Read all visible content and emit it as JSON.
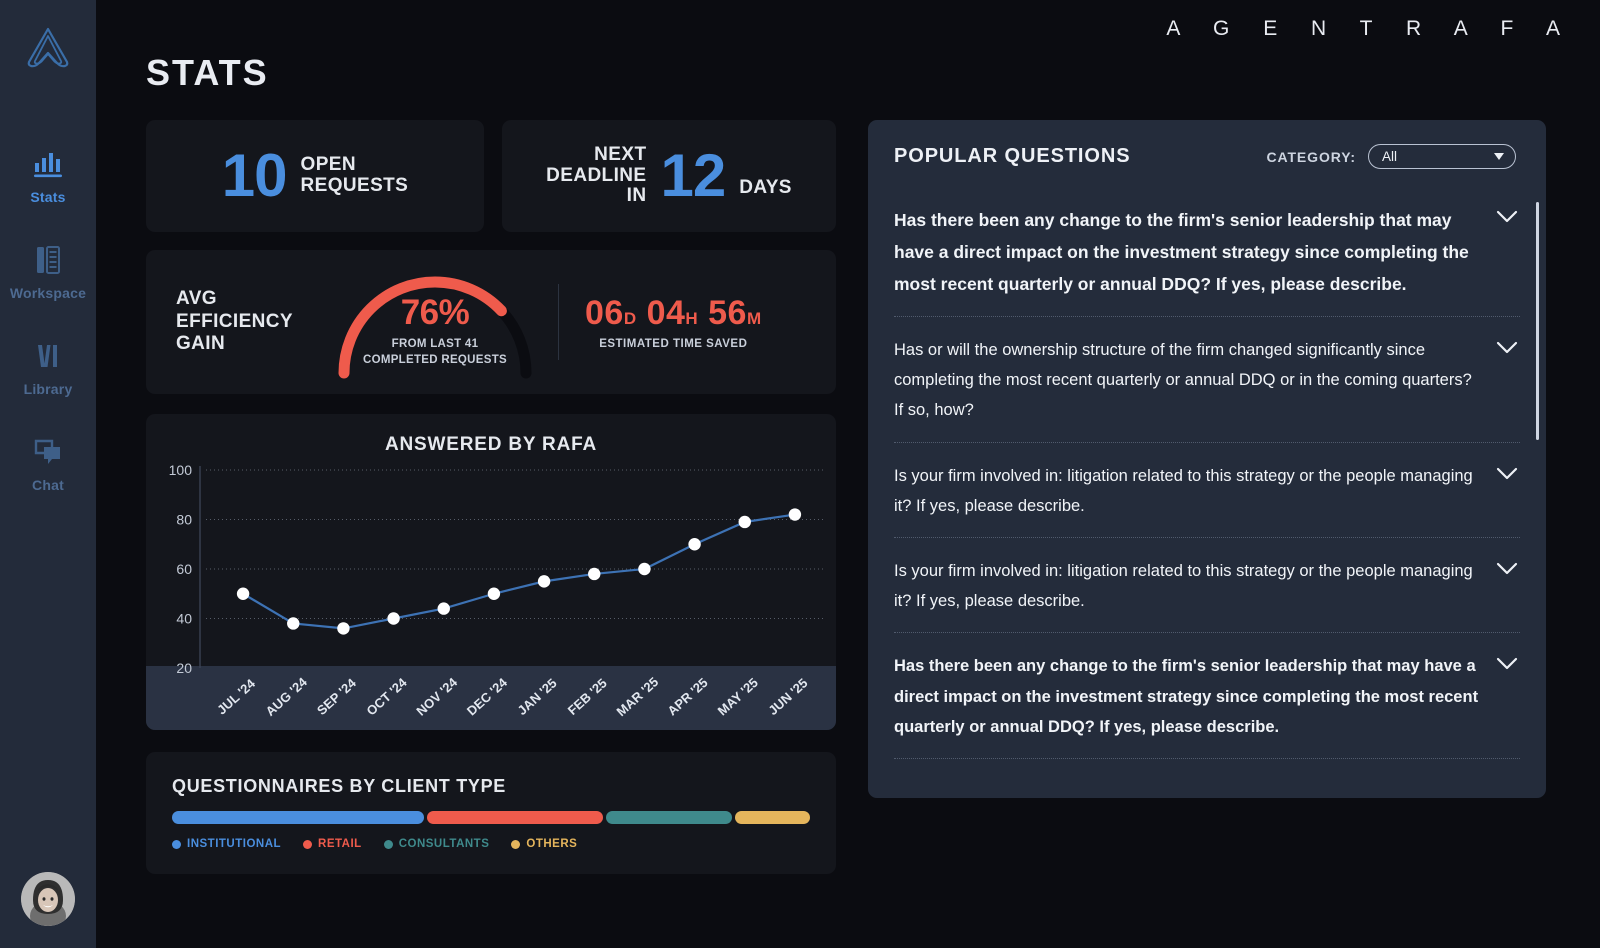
{
  "brand": {
    "title": "A G E N T   R A F A"
  },
  "page": {
    "title": "STATS"
  },
  "sidebar": {
    "logo_name": "rafa-logo",
    "items": [
      {
        "label": "Stats",
        "icon": "bar-chart-icon",
        "active": true
      },
      {
        "label": "Workspace",
        "icon": "workspace-icon",
        "active": false
      },
      {
        "label": "Library",
        "icon": "library-icon",
        "active": false
      },
      {
        "label": "Chat",
        "icon": "chat-icon",
        "active": false
      }
    ],
    "avatar_name": "user-avatar"
  },
  "stats": {
    "open_requests": {
      "value": "10",
      "label_line1": "OPEN",
      "label_line2": "REQUESTS"
    },
    "next_deadline": {
      "label_line1": "NEXT",
      "label_line2": "DEADLINE",
      "label_line3": "IN",
      "value": "12",
      "unit": "DAYS"
    }
  },
  "efficiency": {
    "title_line1": "AVG",
    "title_line2": "EFFICIENCY",
    "title_line3": "GAIN",
    "percent": "76%",
    "percent_value": 76,
    "sub_line1": "FROM LAST 41",
    "sub_line2": "COMPLETED REQUESTS",
    "time_saved": {
      "days": "06",
      "days_unit": "D",
      "hours": "04",
      "hours_unit": "H",
      "minutes": "56",
      "minutes_unit": "M"
    },
    "time_saved_label": "ESTIMATED TIME SAVED",
    "accent": "#ef5b4c"
  },
  "chart_data": {
    "type": "line",
    "title": "ANSWERED BY RAFA",
    "xlabel": "",
    "ylabel": "",
    "ylim": [
      20,
      100
    ],
    "yticks": [
      20,
      40,
      60,
      80,
      100
    ],
    "grid": true,
    "legend": "none",
    "categories": [
      "JUL '24",
      "AUG '24",
      "SEP '24",
      "OCT '24",
      "NOV '24",
      "DEC '24",
      "JAN '25",
      "FEB '25",
      "MAR '25",
      "APR '25",
      "MAY '25",
      "JUN '25"
    ],
    "series": [
      {
        "name": "Answered by Rafa",
        "color": "#3d72b4",
        "marker_color": "#ffffff",
        "values": [
          50,
          38,
          36,
          40,
          44,
          50,
          55,
          58,
          60,
          70,
          79,
          82
        ]
      }
    ]
  },
  "clients": {
    "title": "QUESTIONNAIRES BY CLIENT TYPE",
    "segments": [
      {
        "label": "INSTITUTIONAL",
        "color": "#4a8ede",
        "percent": 40
      },
      {
        "label": "RETAIL",
        "color": "#ef5b4c",
        "percent": 28
      },
      {
        "label": "CONSULTANTS",
        "color": "#3f8a8c",
        "percent": 20
      },
      {
        "label": "OTHERS",
        "color": "#e5b55c",
        "percent": 12
      }
    ]
  },
  "questions_panel": {
    "title": "POPULAR QUESTIONS",
    "category_label": "CATEGORY:",
    "category_value": "All",
    "items": [
      {
        "text": "Has there been any change to the firm's senior leadership that may have a direct impact on the investment strategy since completing the most recent quarterly or annual DDQ? If yes, please describe.",
        "emphasis": "lead"
      },
      {
        "text": "Has or will the ownership structure of the firm changed significantly since completing the most recent quarterly or annual DDQ or in the coming quarters? If so, how?",
        "emphasis": "normal"
      },
      {
        "text": "Is your firm involved in: litigation related to this strategy or the people managing it? If yes, please describe.",
        "emphasis": "normal"
      },
      {
        "text": "Is your firm involved in: litigation related to this strategy or the people managing it? If yes, please describe.",
        "emphasis": "normal"
      },
      {
        "text": "Has there been any change to the firm's senior leadership that may have a direct impact on the investment strategy since completing the most recent quarterly or annual DDQ? If yes, please describe.",
        "emphasis": "bold"
      }
    ]
  }
}
